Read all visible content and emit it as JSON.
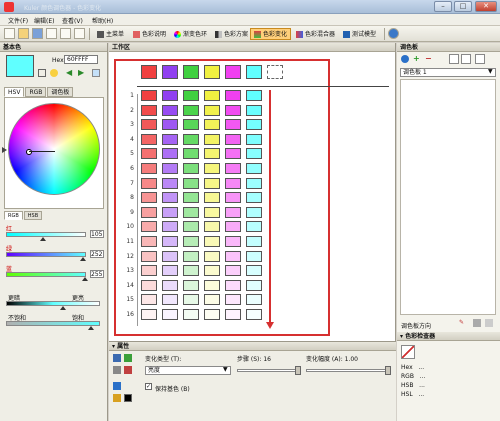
{
  "window": {
    "title": "Kuler 颜色调色器 - 色彩变化"
  },
  "menu": [
    "文件(F)",
    "编辑(E)",
    "查看(V)",
    "帮助(H)"
  ],
  "toolbar": {
    "tabs": [
      "主菜单",
      "色彩说明",
      "渐变色环",
      "色彩方案",
      "色彩变化",
      "色彩混合器",
      "测试模型"
    ],
    "active_tab": "色彩变化"
  },
  "left_panel": {
    "title": "基本色",
    "hex_label": "Hex",
    "hex_value": "60FFFF",
    "subtabs": [
      "HSV",
      "RGB",
      "调色板"
    ],
    "mode_tabs": [
      "RGB",
      "HSB"
    ],
    "sliders": [
      {
        "label": "红",
        "value": "105"
      },
      {
        "label": "绿",
        "value": "252"
      },
      {
        "label": "蓝",
        "value": "255"
      }
    ],
    "bottom_labels": {
      "darker": "更暗",
      "lighter": "更亮",
      "less_sat": "不饱和",
      "more_sat": "饱和"
    }
  },
  "center": {
    "title": "工作区",
    "base_colors": [
      "#f04040",
      "#9040f0",
      "#40d040",
      "#f0f040",
      "#f040f0",
      "#60ffff"
    ],
    "row_numbers": [
      "1",
      "2",
      "3",
      "4",
      "5",
      "6",
      "7",
      "8",
      "9",
      "10",
      "11",
      "12",
      "13",
      "14",
      "15",
      "16"
    ]
  },
  "props": {
    "title": "属性",
    "change_type_label": "变化类型 (T):",
    "change_type_value": "亮度",
    "steps_label": "步骤 (S): 16",
    "variation_label": "变化幅度 (A): 1.00",
    "keep_base_label": "保持基色 (B)"
  },
  "right_panel": {
    "title": "调色板",
    "palette_select": "调色板 1",
    "palette_dir_label": "调色板方向",
    "color_info_title": "色彩检查器",
    "info_rows": [
      {
        "key": "Hex",
        "val": "..."
      },
      {
        "key": "RGB",
        "val": "..."
      },
      {
        "key": "HSB",
        "val": "..."
      },
      {
        "key": "HSL",
        "val": "..."
      }
    ]
  },
  "colors": {
    "accent": "#ffcf7a",
    "highlight_frame": "#d63030"
  }
}
